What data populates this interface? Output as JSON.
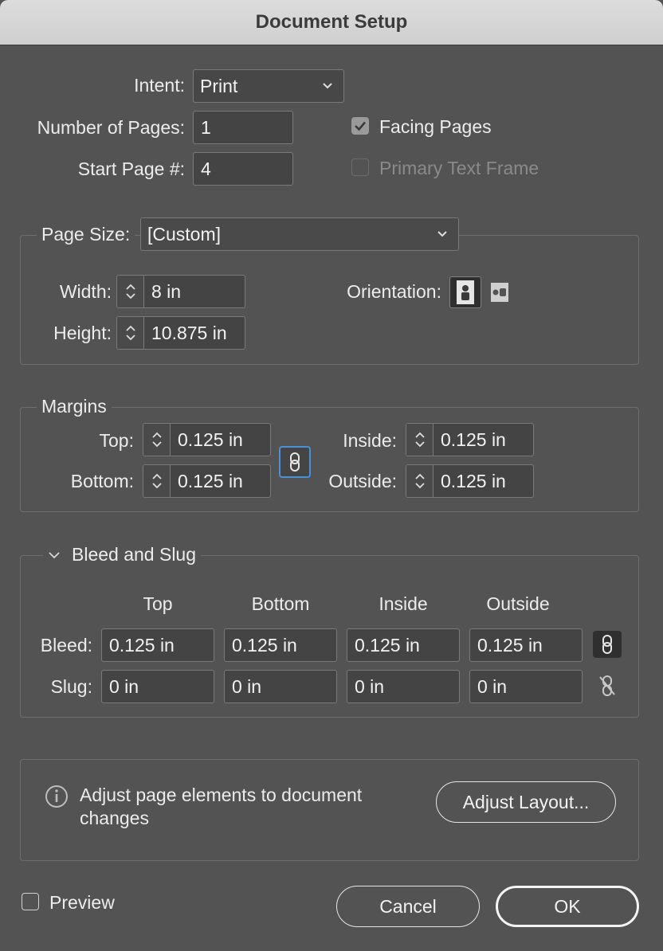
{
  "window": {
    "title": "Document Setup"
  },
  "intent": {
    "label": "Intent:",
    "value": "Print"
  },
  "pages": {
    "label": "Number of Pages:",
    "value": "1"
  },
  "start_page": {
    "label": "Start Page #:",
    "value": "4"
  },
  "facing_pages": {
    "label": "Facing Pages",
    "checked": true
  },
  "primary_text_frame": {
    "label": "Primary Text Frame",
    "checked": false,
    "enabled": false
  },
  "page_size": {
    "label": "Page Size:",
    "value": "[Custom]",
    "width_label": "Width:",
    "width": "8 in",
    "height_label": "Height:",
    "height": "10.875 in",
    "orientation_label": "Orientation:"
  },
  "margins": {
    "legend": "Margins",
    "top_label": "Top:",
    "top": "0.125 in",
    "bottom_label": "Bottom:",
    "bottom": "0.125 in",
    "inside_label": "Inside:",
    "inside": "0.125 in",
    "outside_label": "Outside:",
    "outside": "0.125 in"
  },
  "bleed_slug": {
    "legend": "Bleed and Slug",
    "columns": [
      "Top",
      "Bottom",
      "Inside",
      "Outside"
    ],
    "bleed_label": "Bleed:",
    "bleed": [
      "0.125 in",
      "0.125 in",
      "0.125 in",
      "0.125 in"
    ],
    "slug_label": "Slug:",
    "slug": [
      "0 in",
      "0 in",
      "0 in",
      "0 in"
    ]
  },
  "adjust": {
    "message_line1": "Adjust page elements to document",
    "message_line2": "changes",
    "button": "Adjust Layout..."
  },
  "footer": {
    "preview_label": "Preview",
    "cancel": "Cancel",
    "ok": "OK"
  },
  "colors": {
    "background": "#535353",
    "field": "#444444",
    "accent": "#4a90d9"
  }
}
